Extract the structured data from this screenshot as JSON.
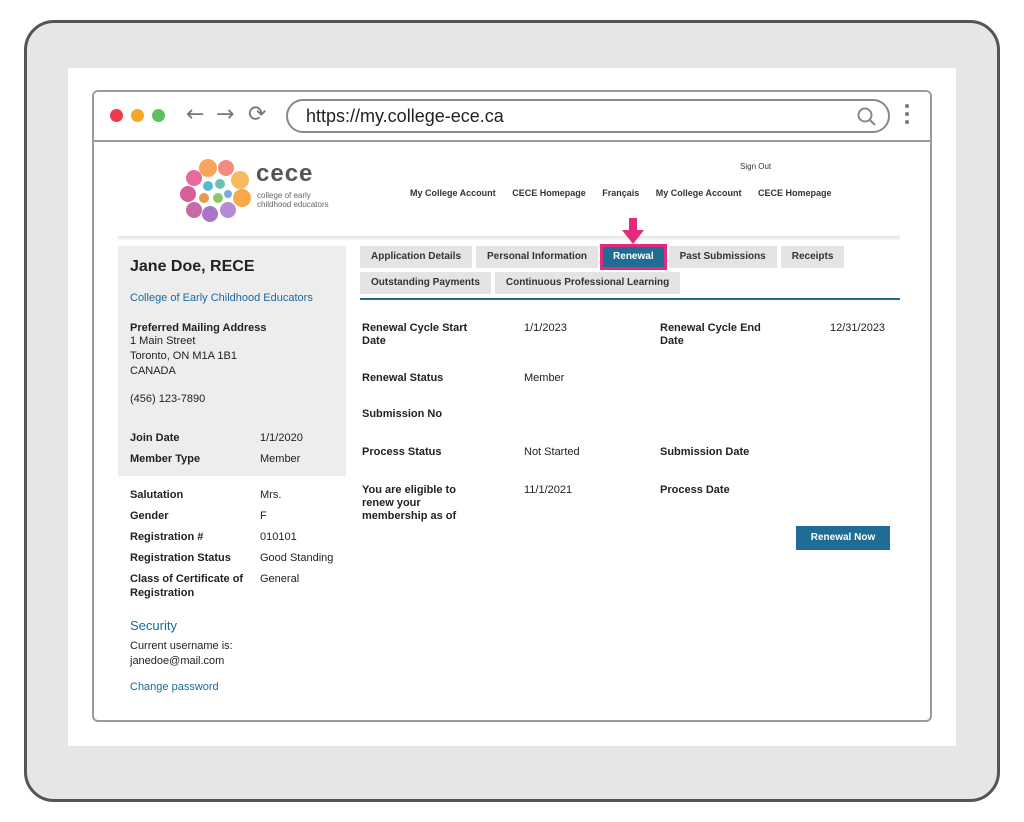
{
  "browser": {
    "url": "https://my.college-ece.ca",
    "icons": {
      "back": "back-arrow-icon",
      "forward": "forward-arrow-icon",
      "reload": "reload-icon",
      "search": "search-icon",
      "menu": "kebab-menu-icon"
    }
  },
  "header": {
    "logo_word": "cece",
    "logo_sub": "college of early childhood educators",
    "sign_out": "Sign Out",
    "nav_links": [
      "My College Account",
      "CECE Homepage",
      "Français",
      "My College Account",
      "CECE Homepage"
    ]
  },
  "sidebar": {
    "name": "Jane Doe, RECE",
    "org": "College of Early Childhood Educators",
    "mailing_heading": "Preferred Mailing Address",
    "address_line1": "1 Main Street",
    "address_line2": "Toronto, ON  M1A 1B1",
    "address_line3": "CANADA",
    "phone": "(456) 123-7890",
    "join_date_label": "Join Date",
    "join_date": "1/1/2020",
    "member_type_label": "Member Type",
    "member_type": "Member",
    "salutation_label": "Salutation",
    "salutation": "Mrs.",
    "gender_label": "Gender",
    "gender": "F",
    "registration_label": "Registration #",
    "registration": "010101",
    "reg_status_label": "Registration Status",
    "reg_status": "Good Standing",
    "class_label": "Class of Certificate of Registration",
    "class_value": "General",
    "security_title": "Security",
    "username_label": "Current username is:",
    "username": "janedoe@mail.com",
    "change_password": "Change password"
  },
  "tabs": {
    "row1": [
      "Application Details",
      "Personal Information",
      "Renewal",
      "Past Submissions",
      "Receipts"
    ],
    "row2": [
      "Outstanding Payments",
      "Continuous Professional Learning"
    ],
    "active": "Renewal",
    "accent": "#1f6c95",
    "highlight": "#e2297b"
  },
  "renewal": {
    "start_label": "Renewal Cycle Start Date",
    "start_value": "1/1/2023",
    "end_label": "Renewal Cycle End Date",
    "end_value": "12/31/2023",
    "status_label": "Renewal Status",
    "status_value": "Member",
    "submission_no_label": "Submission No",
    "process_status_label": "Process Status",
    "process_status_value": "Not Started",
    "submission_date_label": "Submission Date",
    "eligible_label": "You are eligible to renew your membership as of",
    "eligible_value": "11/1/2021",
    "process_date_label": "Process Date",
    "renew_button": "Renewal Now"
  }
}
